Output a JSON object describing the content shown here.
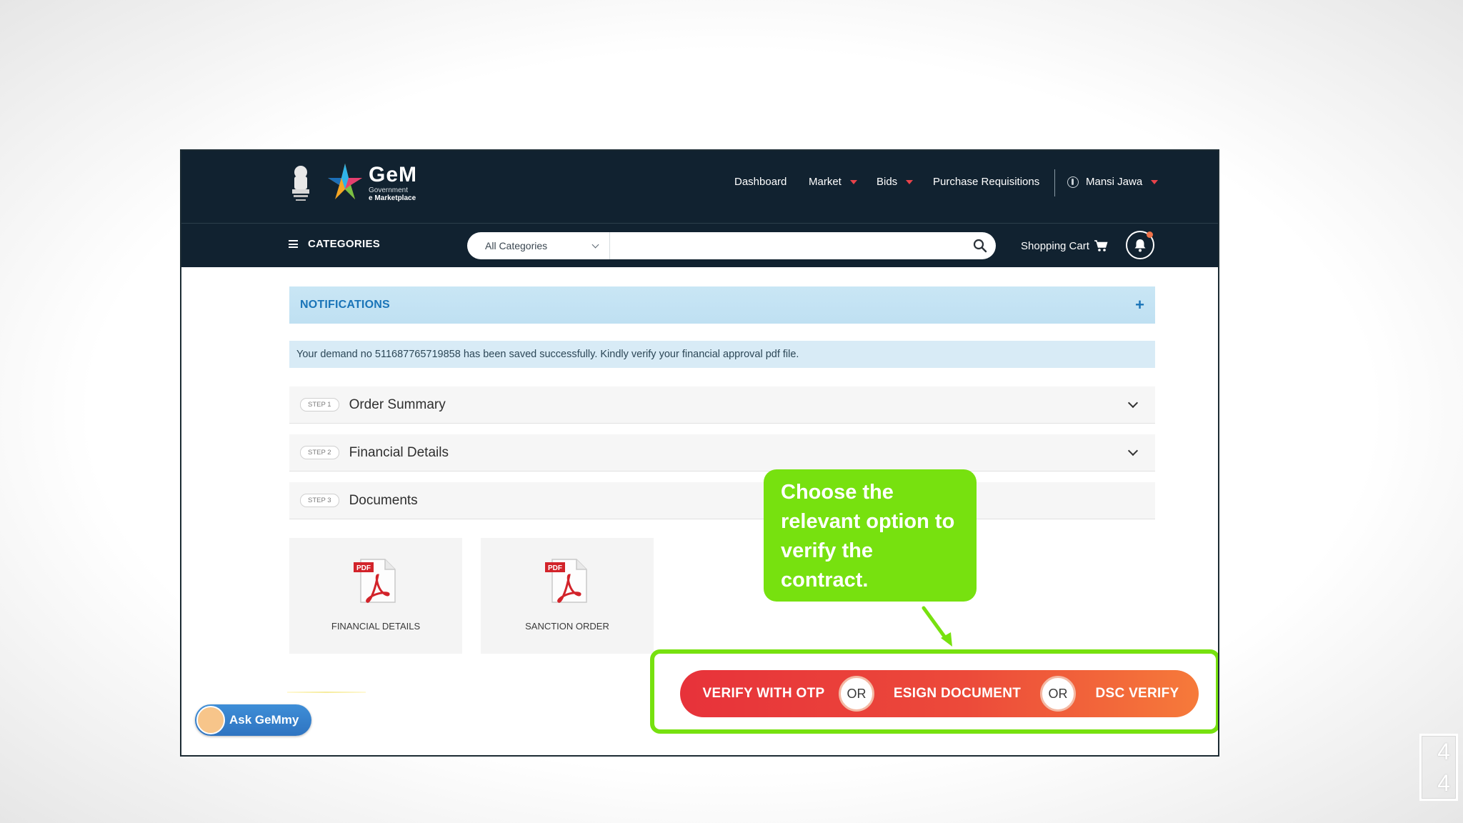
{
  "header": {
    "brand_title": "GeM",
    "brand_sub1": "Government",
    "brand_sub2": "e Marketplace",
    "nav": {
      "dashboard": "Dashboard",
      "market": "Market",
      "bids": "Bids",
      "purchase_requisitions": "Purchase Requisitions",
      "user": "Mansi Jawa"
    }
  },
  "subbar": {
    "categories": "CATEGORIES",
    "select_value": "All Categories",
    "search_placeholder": "",
    "cart": "Shopping Cart"
  },
  "notifications": {
    "title": "NOTIFICATIONS",
    "expand": "+"
  },
  "alert": "Your demand no 511687765719858 has been saved successfully. Kindly verify your financial approval pdf file.",
  "steps": [
    {
      "badge": "STEP 1",
      "title": "Order Summary"
    },
    {
      "badge": "STEP 2",
      "title": "Financial Details"
    },
    {
      "badge": "STEP 3",
      "title": "Documents"
    }
  ],
  "documents": [
    {
      "label": "FINANCIAL DETAILS",
      "icon_tag": "PDF"
    },
    {
      "label": "SANCTION ORDER",
      "icon_tag": "PDF"
    }
  ],
  "callout": "Choose the relevant option to verify the contract.",
  "verify": {
    "otp": "VERIFY WITH OTP",
    "or1": "OR",
    "esign": "ESIGN DOCUMENT",
    "or2": "OR",
    "dsc": "DSC VERIFY"
  },
  "ask_gemmy": "Ask GeMmy",
  "slide_number": "4\n4",
  "colors": {
    "header_bg": "#112230",
    "notif_bg": "#c9e6f5",
    "accent_green": "#77e10f",
    "verify_red": "#e7323a",
    "verify_orange": "#f67a3a"
  }
}
